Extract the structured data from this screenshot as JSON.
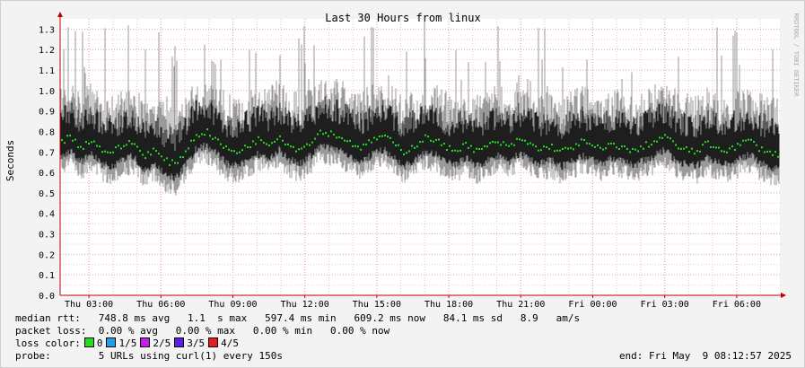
{
  "side_label": "RRDTOOL / TOBI OETIKER",
  "chart_data": {
    "type": "line",
    "title": "Last 30 Hours from linux",
    "ylabel": "Seconds",
    "xlabel": "",
    "ylim": [
      0,
      1.35
    ],
    "y_ticks": [
      "0.0",
      "0.1",
      "0.2",
      "0.3",
      "0.4",
      "0.5",
      "0.6",
      "0.7",
      "0.8",
      "0.9",
      "1.0",
      "1.1",
      "1.2",
      "1.3"
    ],
    "x_ticks": [
      "Thu 03:00",
      "Thu 06:00",
      "Thu 09:00",
      "Thu 12:00",
      "Thu 15:00",
      "Thu 18:00",
      "Thu 21:00",
      "Fri 00:00",
      "Fri 03:00",
      "Fri 06:00"
    ],
    "grid": true,
    "series": [
      {
        "name": "median rtt",
        "color": "#22dd22",
        "values": [
          0.74,
          0.78,
          0.72,
          0.76,
          0.71,
          0.7,
          0.73,
          0.75,
          0.68,
          0.71,
          0.66,
          0.64,
          0.7,
          0.78,
          0.8,
          0.76,
          0.71,
          0.7,
          0.73,
          0.76,
          0.74,
          0.78,
          0.73,
          0.71,
          0.75,
          0.8,
          0.79,
          0.77,
          0.74,
          0.72,
          0.76,
          0.78,
          0.74,
          0.7,
          0.73,
          0.77,
          0.76,
          0.72,
          0.71,
          0.74,
          0.7,
          0.73,
          0.75,
          0.72,
          0.76,
          0.74,
          0.71,
          0.73,
          0.7,
          0.72,
          0.75,
          0.73,
          0.71,
          0.74,
          0.72,
          0.7,
          0.73,
          0.75,
          0.78,
          0.73,
          0.71,
          0.7,
          0.74,
          0.72,
          0.71,
          0.73,
          0.76,
          0.72,
          0.7,
          0.68
        ]
      }
    ]
  },
  "legend": {
    "median_rtt": "median rtt:   748.8 ms avg   1.1  s max   597.4 ms min   609.2 ms now   84.1 ms sd   8.9   am/s",
    "packet_loss": "packet loss:  0.00 % avg   0.00 % max   0.00 % min   0.00 % now",
    "loss_color_label": "loss color:",
    "loss_colors": [
      {
        "label": "0",
        "color": "#22dd22"
      },
      {
        "label": "1/5",
        "color": "#1e9fe8"
      },
      {
        "label": "2/5",
        "color": "#c21ee8"
      },
      {
        "label": "3/5",
        "color": "#5b1ee8"
      },
      {
        "label": "4/5",
        "color": "#e81e1e"
      }
    ],
    "probe": "probe:        5 URLs using curl(1) every 150s",
    "end": "end: Fri May  9 08:12:57 2025"
  }
}
